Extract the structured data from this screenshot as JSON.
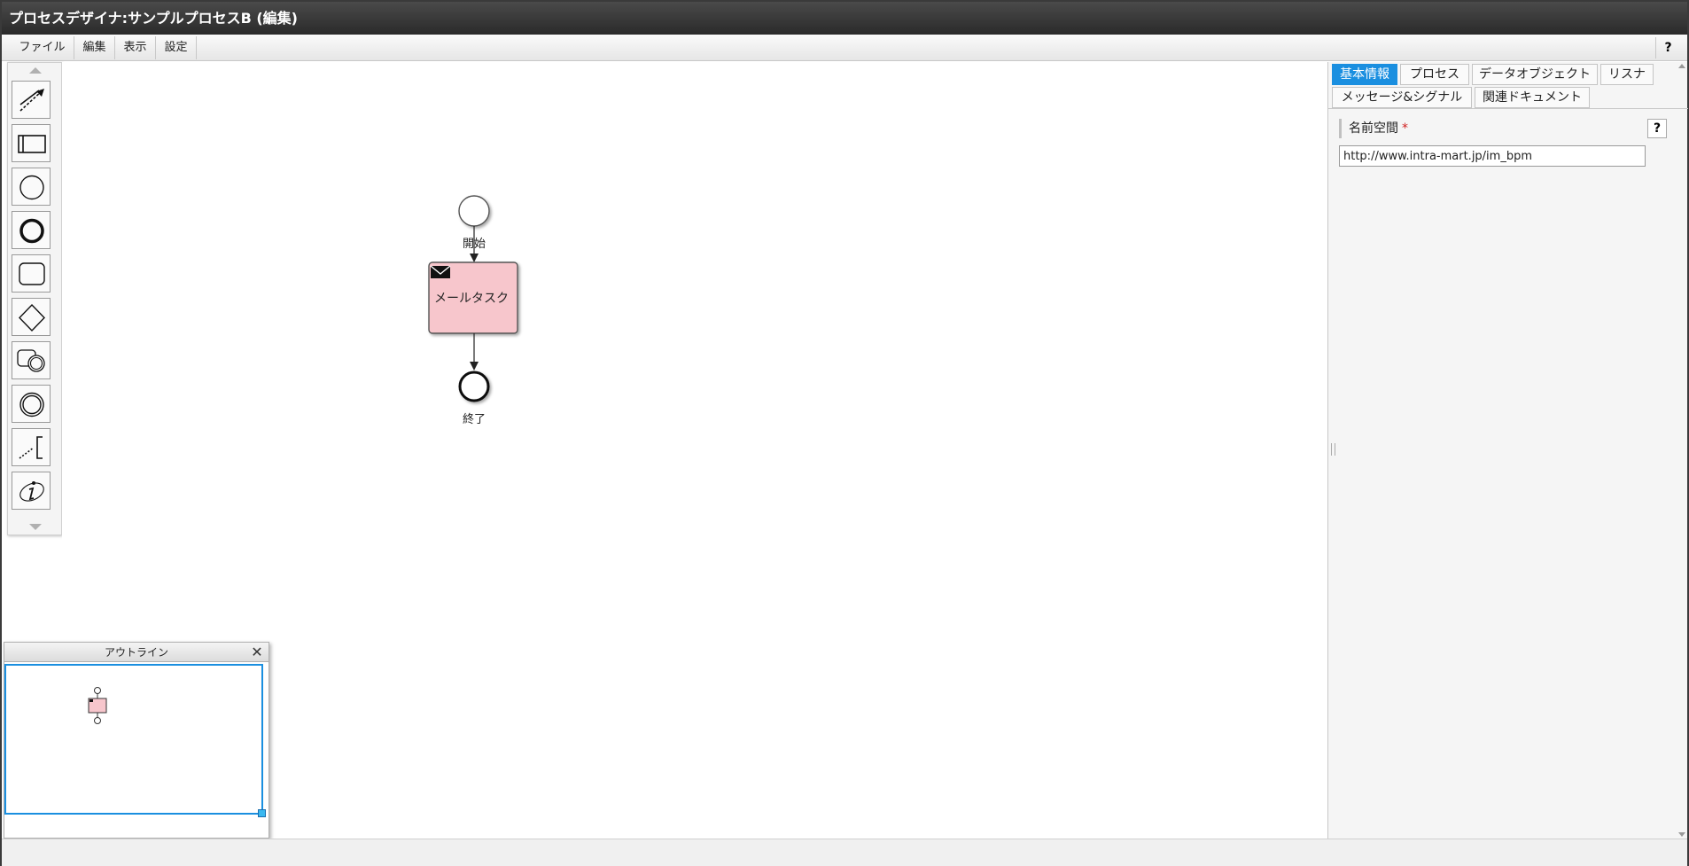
{
  "window": {
    "title": "プロセスデザイナ:サンプルプロセスB (編集)"
  },
  "menubar": {
    "items": [
      {
        "label": "ファイル"
      },
      {
        "label": "編集"
      },
      {
        "label": "表示"
      },
      {
        "label": "設定"
      }
    ],
    "help_label": "?"
  },
  "palette": {
    "tools": [
      {
        "icon": "sequence-flow-icon"
      },
      {
        "icon": "pool-lane-icon"
      },
      {
        "icon": "start-event-icon"
      },
      {
        "icon": "end-event-icon"
      },
      {
        "icon": "task-icon"
      },
      {
        "icon": "gateway-icon"
      },
      {
        "icon": "subprocess-icon"
      },
      {
        "icon": "intermediate-event-icon"
      },
      {
        "icon": "annotation-icon"
      },
      {
        "icon": "info-icon"
      }
    ]
  },
  "diagram": {
    "start_label": "開始",
    "task_label": "メールタスク",
    "end_label": "終了",
    "task_fill": "#f7c6cc"
  },
  "outline": {
    "title": "アウトライン",
    "close_label": "✕"
  },
  "properties": {
    "tabs": [
      {
        "label": "基本情報",
        "active": true
      },
      {
        "label": "プロセス",
        "active": false
      },
      {
        "label": "データオブジェクト",
        "active": false
      },
      {
        "label": "リスナ",
        "active": false
      },
      {
        "label": "メッセージ&シグナル",
        "active": false
      },
      {
        "label": "関連ドキュメント",
        "active": false
      }
    ],
    "namespace_label": "名前空間",
    "required_mark": "*",
    "help_label": "?",
    "namespace_value": "http://www.intra-mart.jp/im_bpm"
  },
  "colors": {
    "accent": "#1a8fe0",
    "titlebar": "#2f2f2f"
  }
}
